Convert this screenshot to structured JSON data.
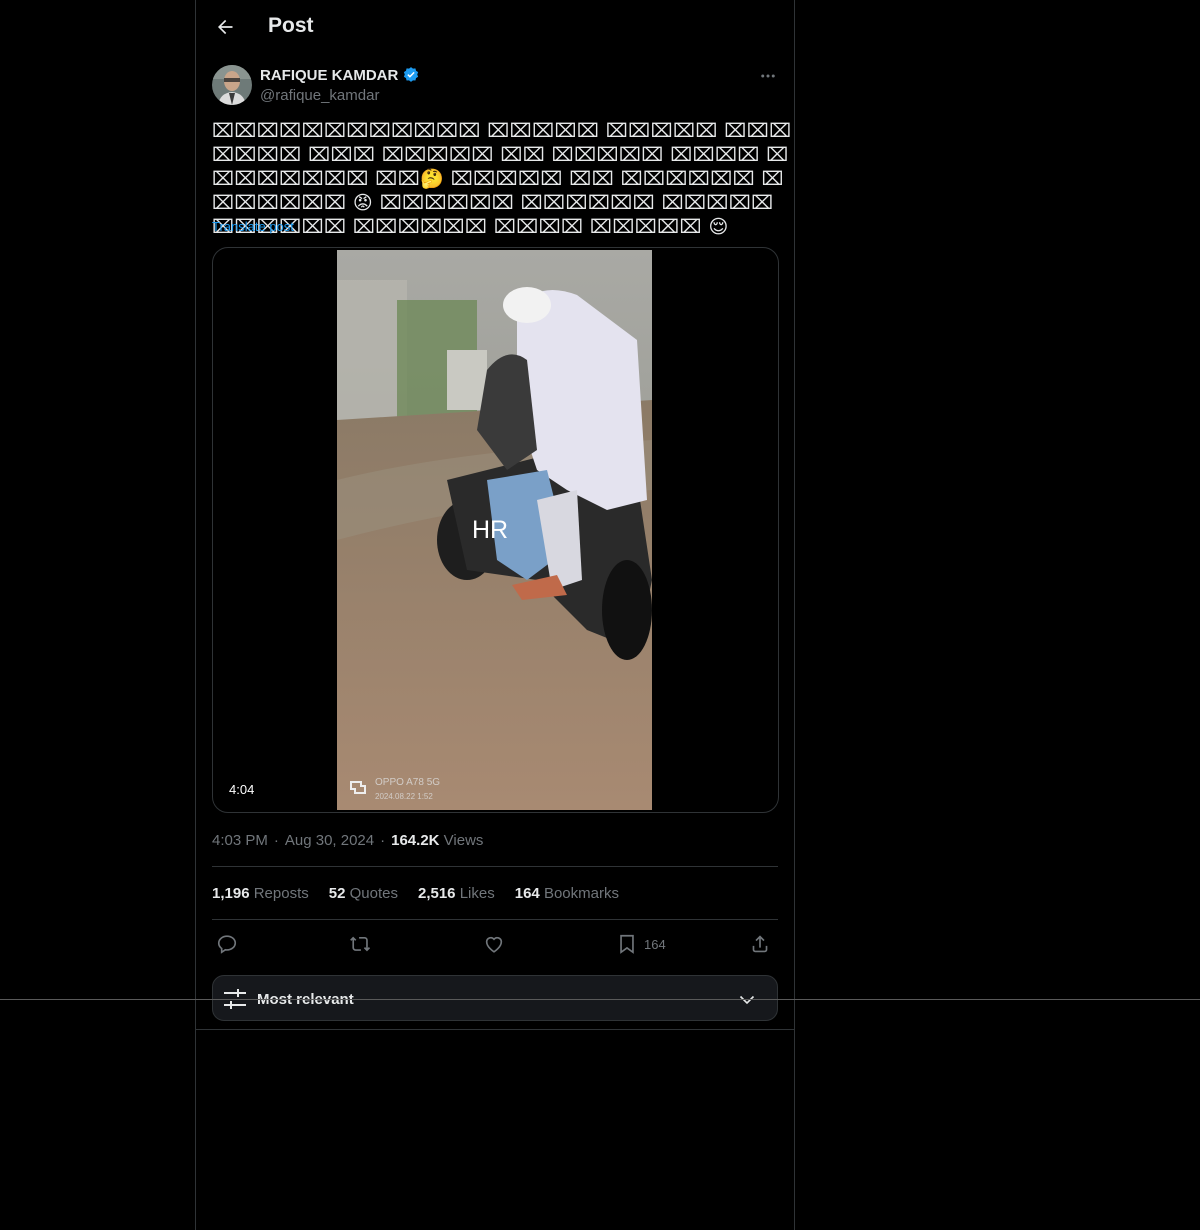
{
  "header": {
    "title": "Post",
    "back_icon": "arrow-left-icon"
  },
  "author": {
    "name": "RAFIQUE KAMDAR",
    "handle": "@rafique_kamdar",
    "verified": true,
    "verified_color": "#1d9bf0"
  },
  "post": {
    "text": "⌧⌧⌧⌧⌧⌧⌧⌧⌧⌧⌧⌧ ⌧⌧⌧⌧⌧ ⌧⌧⌧⌧⌧ ⌧⌧⌧⌧⌧⌧⌧ ⌧⌧⌧ ⌧⌧⌧⌧⌧ ⌧⌧ ⌧⌧⌧⌧⌧ ⌧⌧⌧⌧ ⌧⌧⌧⌧⌧⌧⌧⌧ ⌧⌧🤔 ⌧⌧⌧⌧⌧ ⌧⌧ ⌧⌧⌧⌧⌧⌧ ⌧⌧⌧⌧⌧⌧⌧ 😡 ⌧⌧⌧⌧⌧⌧ ⌧⌧⌧⌧⌧⌧ ⌧⌧⌧⌧⌧ ⌧⌧⌧⌧⌧⌧ ⌧⌧⌧⌧⌧⌧ ⌧⌧⌧⌧ ⌧⌧⌧⌧⌧ 😌",
    "translate_label": "Translate post"
  },
  "media": {
    "duration": "4:04",
    "overlay_text": "HR",
    "watermark_line1": "OPPO A78 5G",
    "watermark_line2": "2024.08.22 1:52"
  },
  "meta": {
    "time": "4:03 PM",
    "separator": "·",
    "date": "Aug 30, 2024",
    "views_count": "164.2K",
    "views_label": "Views"
  },
  "stats": [
    {
      "count": "1,196",
      "label": "Reposts"
    },
    {
      "count": "52",
      "label": "Quotes"
    },
    {
      "count": "2,516",
      "label": "Likes"
    },
    {
      "count": "164",
      "label": "Bookmarks"
    }
  ],
  "actions": {
    "reply_icon": "reply-icon",
    "repost_icon": "repost-icon",
    "like_icon": "heart-icon",
    "bookmark_icon": "bookmark-icon",
    "bookmark_count": "164",
    "share_icon": "share-icon"
  },
  "sort": {
    "label": "Most relevant",
    "icon": "sliders-icon",
    "chevron": "chevron-down-icon"
  },
  "colors": {
    "background": "#000000",
    "text": "#e7e9ea",
    "muted": "#71767b",
    "accent": "#1d9bf0",
    "border": "#2f3336"
  }
}
